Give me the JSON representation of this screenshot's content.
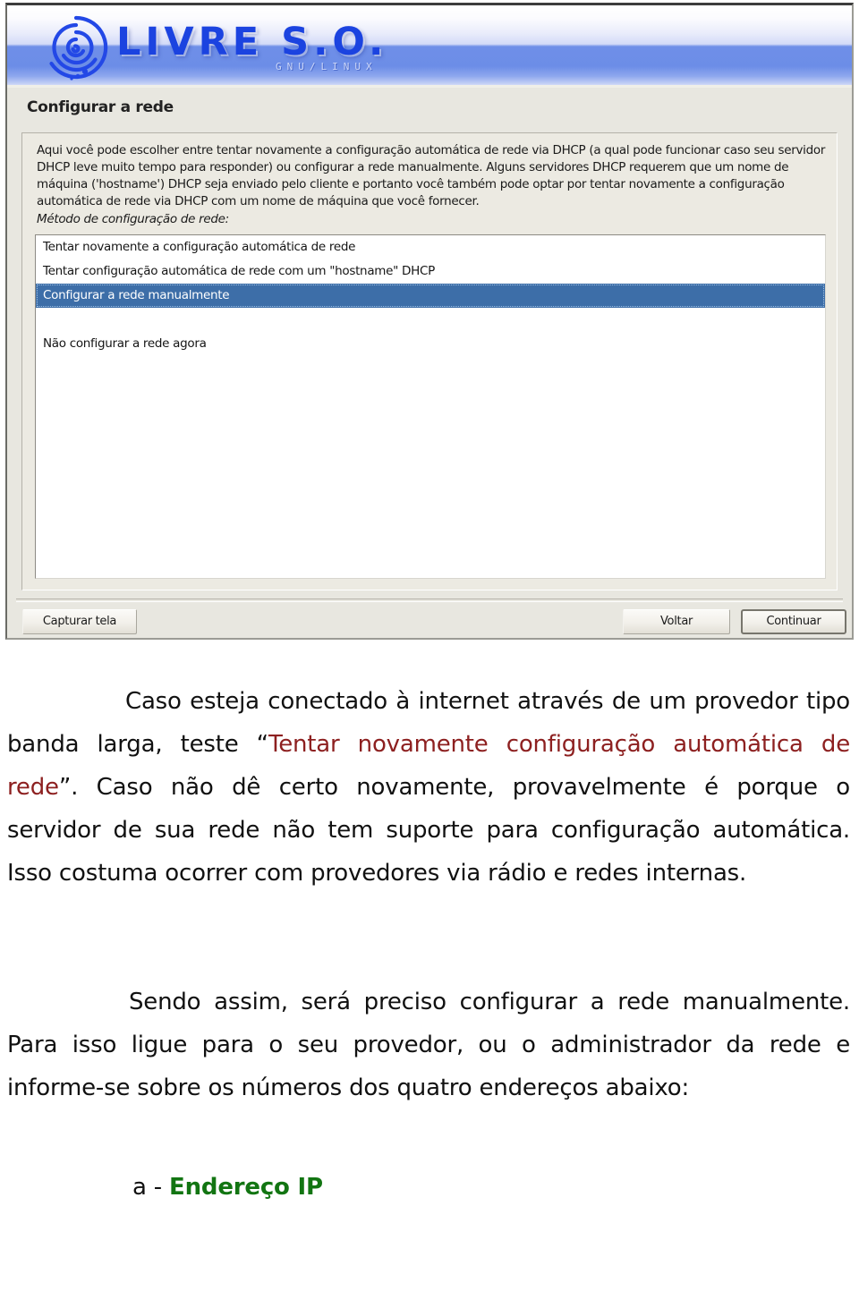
{
  "screenshot": {
    "banner": {
      "logo_text": "LIVRE S.O.",
      "logo_subtitle": "GNU/LINUX",
      "logo_icon": "spiral-logo-icon"
    },
    "page_title": "Configurar a rede",
    "description": "Aqui você pode escolher entre tentar novamente a configuração automática de rede via DHCP (a qual pode funcionar caso seu servidor DHCP leve muito tempo para responder) ou configurar a rede manualmente. Alguns servidores DHCP requerem que um nome de máquina ('hostname') DHCP seja enviado pelo cliente e portanto você também pode optar por tentar novamente a configuração automática de rede via DHCP com um nome de máquina que você fornecer.",
    "field_label": "Método de configuração de rede:",
    "options": [
      {
        "label": "Tentar novamente a configuração automática de rede",
        "selected": false
      },
      {
        "label": "Tentar configuração automática de rede com um \"hostname\" DHCP",
        "selected": false
      },
      {
        "label": "Configurar a rede manualmente",
        "selected": true
      },
      {
        "label": "Não configurar a rede agora",
        "selected": false
      }
    ],
    "buttons": {
      "capture": "Capturar tela",
      "back": "Voltar",
      "continue": "Continuar"
    },
    "colors": {
      "selection_blue": "#3d6ea8",
      "logo_blue": "#1b43e0",
      "window_bg": "#e8e7e0"
    }
  },
  "document": {
    "paragraph1": {
      "before": "Caso esteja conectado à internet através de um provedor tipo banda larga, teste “",
      "highlight": "Tentar novamente configuração automática de rede",
      "after": "”. Caso não dê certo novamente, provavelmente é porque o servidor de sua rede não tem suporte para configuração automática. Isso costuma ocorrer com provedores via rádio e redes internas."
    },
    "paragraph2": "Sendo assim, será preciso configurar a rede manualmente. Para isso ligue para o seu provedor, ou o administrador da rede e informe-se sobre os números dos quatro endereços abaixo:",
    "item_a": {
      "marker": "a - ",
      "label": "Endereço IP"
    },
    "colors": {
      "quote_red": "#8d2020",
      "item_green": "#127512"
    }
  }
}
